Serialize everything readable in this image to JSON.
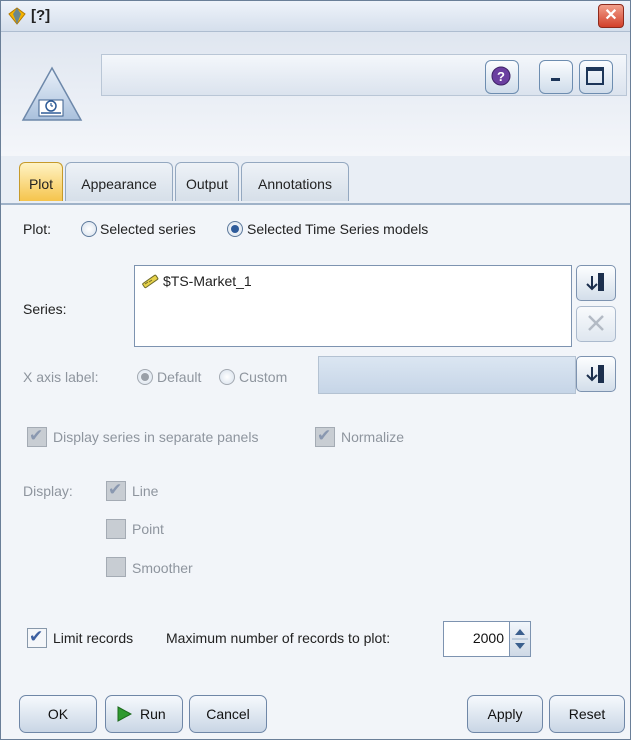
{
  "window": {
    "title": "[?]",
    "close_glyph": "✕"
  },
  "header": {
    "node_icon": "time-plot-node-icon",
    "name_value": "",
    "help_icon": "help-icon",
    "minimize_icon": "minimize-icon",
    "maximize_icon": "maximize-icon"
  },
  "tabs": [
    {
      "label": "Plot",
      "active": true
    },
    {
      "label": "Appearance",
      "active": false
    },
    {
      "label": "Output",
      "active": false
    },
    {
      "label": "Annotations",
      "active": false
    }
  ],
  "plot": {
    "label": "Plot:",
    "options": [
      {
        "label": "Selected series",
        "selected": false
      },
      {
        "label": "Selected Time Series models",
        "selected": true
      }
    ]
  },
  "series": {
    "label": "Series:",
    "items": [
      {
        "name": "$TS-Market_1",
        "icon": "model-icon"
      }
    ],
    "pick_icon": "field-picker-icon",
    "delete_icon": "delete-icon"
  },
  "x_axis": {
    "label": "X axis label:",
    "options": [
      {
        "label": "Default",
        "selected": true
      },
      {
        "label": "Custom",
        "selected": false
      }
    ],
    "value": "",
    "pick_icon": "field-picker-icon"
  },
  "display_series_separate": {
    "label": "Display series in separate panels",
    "checked": true,
    "enabled": false
  },
  "normalize": {
    "label": "Normalize",
    "checked": true,
    "enabled": false
  },
  "display": {
    "label": "Display:",
    "options": [
      {
        "label": "Line",
        "checked": true
      },
      {
        "label": "Point",
        "checked": false
      },
      {
        "label": "Smoother",
        "checked": false
      }
    ]
  },
  "limit_records": {
    "label": "Limit records",
    "checked": true
  },
  "max_records": {
    "label": "Maximum number of records to plot:",
    "value": "2000"
  },
  "buttons": {
    "ok": "OK",
    "run": "Run",
    "cancel": "Cancel",
    "apply": "Apply",
    "reset": "Reset"
  },
  "colors": {
    "active_tab": "#f5c44c",
    "accent": "#2e5b9a",
    "close": "#d2402a"
  }
}
